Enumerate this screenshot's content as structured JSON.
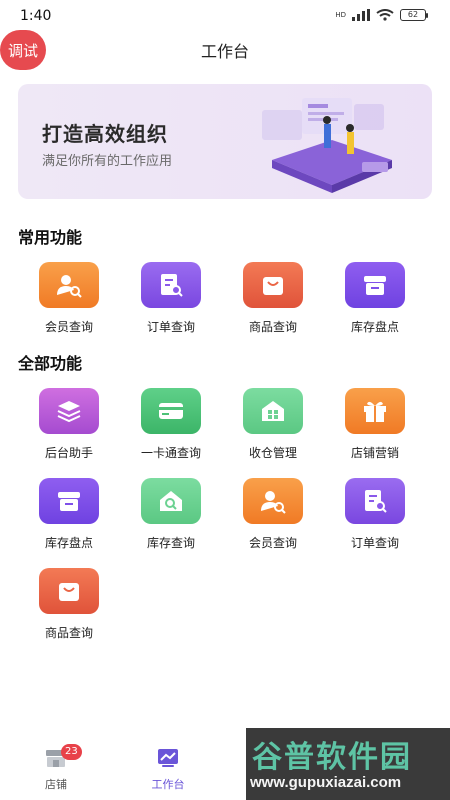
{
  "status": {
    "time": "1:40",
    "battery": "62",
    "network": "HD"
  },
  "header": {
    "debug_badge": "调试",
    "title": "工作台"
  },
  "banner": {
    "title": "打造高效组织",
    "subtitle": "满足你所有的工作应用"
  },
  "common": {
    "title": "常用功能",
    "items": [
      {
        "label": "会员查询",
        "icon": "member-search-icon",
        "color": "#f58a36"
      },
      {
        "label": "订单查询",
        "icon": "order-search-icon",
        "color": "#8a59ea"
      },
      {
        "label": "商品查询",
        "icon": "product-bag-icon",
        "color": "#ea6545"
      },
      {
        "label": "库存盘点",
        "icon": "inventory-box-icon",
        "color": "#7f50e9"
      }
    ]
  },
  "all": {
    "title": "全部功能",
    "items": [
      {
        "label": "后台助手",
        "icon": "layers-icon",
        "color": "#bb5dd8"
      },
      {
        "label": "一卡通查询",
        "icon": "card-icon",
        "color": "#4dc278"
      },
      {
        "label": "收仓管理",
        "icon": "warehouse-icon",
        "color": "#6cd292"
      },
      {
        "label": "店铺营销",
        "icon": "gift-icon",
        "color": "#f58a36"
      },
      {
        "label": "库存盘点",
        "icon": "inventory-box-icon",
        "color": "#7f50e9"
      },
      {
        "label": "库存查询",
        "icon": "house-search-icon",
        "color": "#6cd292"
      },
      {
        "label": "会员查询",
        "icon": "member-search-icon",
        "color": "#f58a36"
      },
      {
        "label": "订单查询",
        "icon": "order-search-icon",
        "color": "#8a59ea"
      },
      {
        "label": "商品查询",
        "icon": "product-bag-icon",
        "color": "#ea6545"
      }
    ]
  },
  "tabs": [
    {
      "label": "店铺",
      "badge": "23",
      "icon": "store-icon"
    },
    {
      "label": "工作台",
      "icon": "chart-icon",
      "active": true
    }
  ],
  "watermark": {
    "line1": "谷普软件园",
    "line2": "www.gupuxiazai.com"
  }
}
